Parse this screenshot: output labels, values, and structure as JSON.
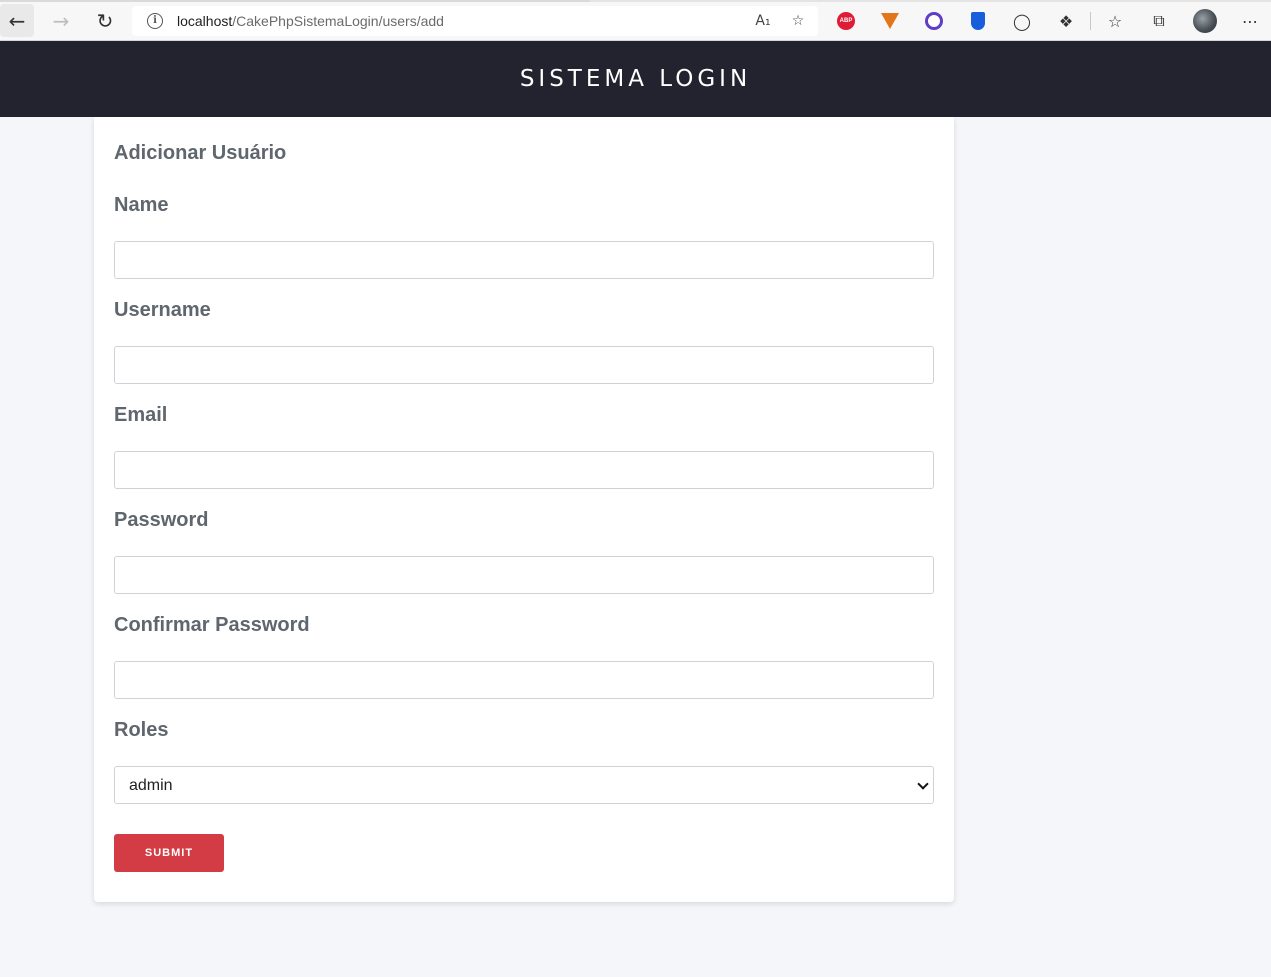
{
  "browser": {
    "url_host": "localhost",
    "url_path": "/CakePhpSistemaLogin/users/add",
    "icons": {
      "back": "back-arrow-icon",
      "forward": "forward-arrow-icon",
      "reload": "reload-icon",
      "info": "info-icon",
      "read_aloud": "read-aloud-icon",
      "add_favorite": "add-favorite-icon",
      "favorites": "favorites-icon",
      "collections": "collections-icon",
      "extensions": "extensions-icon",
      "more": "more-icon"
    },
    "extensions": {
      "adblock_label": "ABP"
    }
  },
  "header": {
    "title": "SISTEMA LOGIN"
  },
  "form": {
    "title": "Adicionar Usuário",
    "fields": {
      "name_label": "Name",
      "username_label": "Username",
      "email_label": "Email",
      "password_label": "Password",
      "confirm_password_label": "Confirmar Password",
      "roles_label": "Roles"
    },
    "roles_selected": "admin",
    "submit_label": "SUBMIT"
  },
  "colors": {
    "header_bg": "#23232f",
    "submit_bg": "#d33c45",
    "page_bg": "#f5f6f9",
    "label_text": "#5f666d"
  }
}
